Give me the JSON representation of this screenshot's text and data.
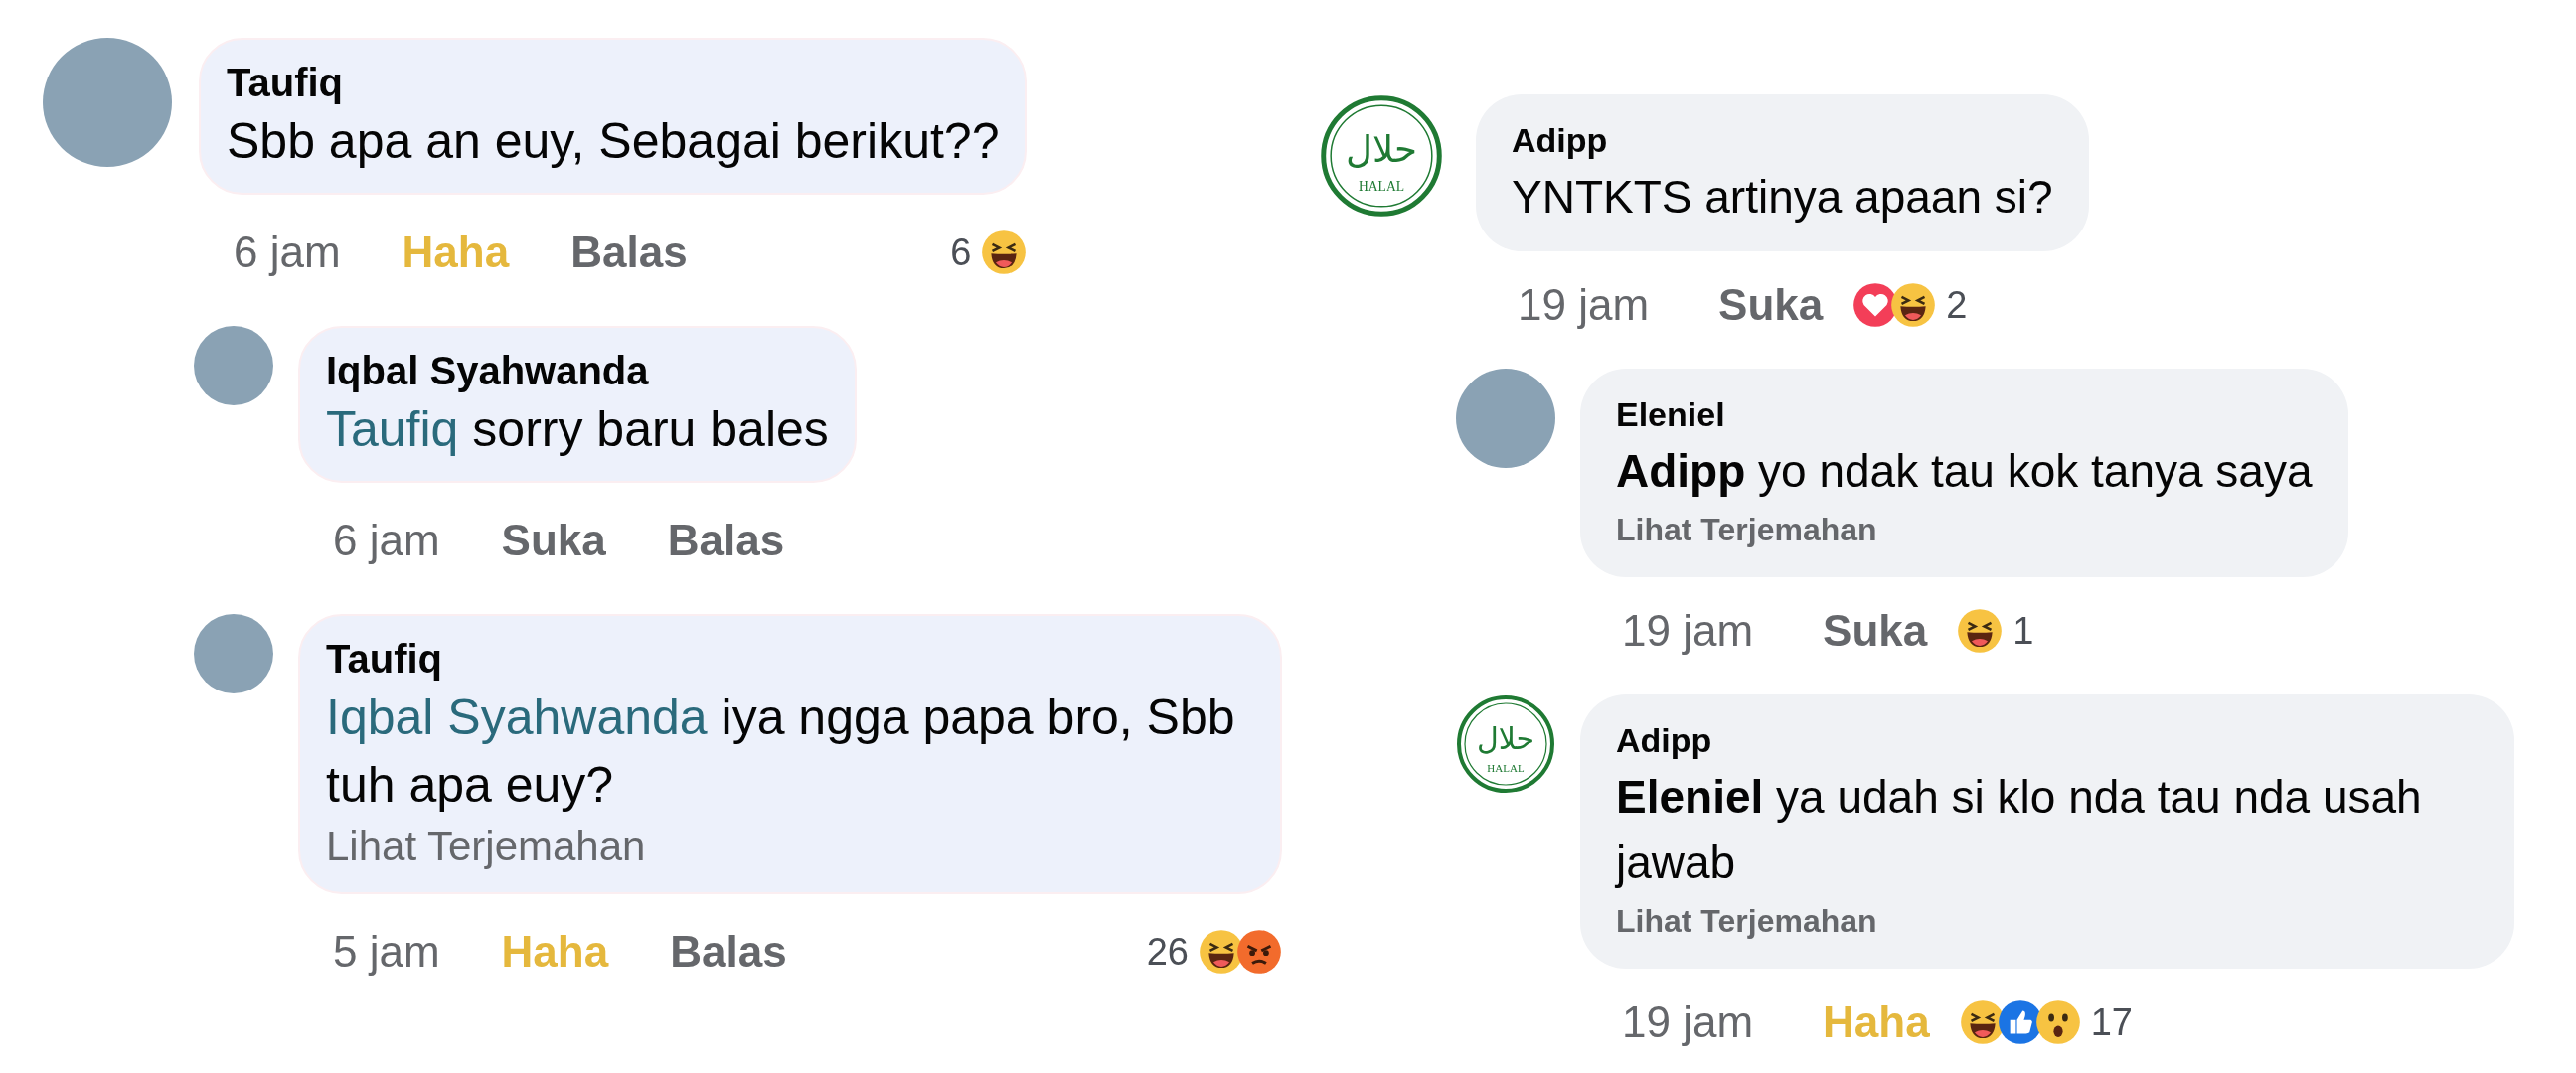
{
  "panels": [
    {
      "kind": "blue",
      "comments": [
        {
          "avatar": {
            "kind": "photo"
          },
          "name": "Taufiq",
          "text": "Sbb apa an euy, Sebagai berikut??",
          "time": "6 jam",
          "actions": [
            {
              "kind": "react",
              "label": "Haha",
              "reacted": true
            },
            {
              "kind": "reply",
              "label": "Balas"
            }
          ],
          "reactions": {
            "icons": [
              {
                "kind": "haha"
              }
            ],
            "count": "6"
          },
          "children": [
            {
              "avatar": {
                "kind": "photo"
              },
              "name": "Iqbal Syahwanda",
              "mention": "Taufiq",
              "text": " sorry baru bales",
              "time": "6 jam",
              "actions": [
                {
                  "kind": "react",
                  "label": "Suka",
                  "reacted": false
                },
                {
                  "kind": "reply",
                  "label": "Balas"
                }
              ]
            },
            {
              "avatar": {
                "kind": "photo"
              },
              "name": "Taufiq",
              "mention": "Iqbal Syahwanda",
              "text": " iya ngga papa bro, Sbb tuh apa euy?",
              "translate": "Lihat Terjemahan",
              "time": "5 jam",
              "actions": [
                {
                  "kind": "react",
                  "label": "Haha",
                  "reacted": true
                },
                {
                  "kind": "reply",
                  "label": "Balas"
                }
              ],
              "reactions": {
                "icons": [
                  {
                    "kind": "haha"
                  },
                  {
                    "kind": "angry"
                  }
                ],
                "count": "26"
              }
            }
          ]
        }
      ]
    },
    {
      "kind": "grey",
      "comments": [
        {
          "avatar": {
            "kind": "logo",
            "script": "حلال",
            "caption": "HALAL"
          },
          "name": "Adipp",
          "text": "YNTKTS artinya apaan si?",
          "time": "19 jam",
          "actions": [
            {
              "kind": "react",
              "label": "Suka",
              "reacted": false
            }
          ],
          "reactions": {
            "icons": [
              {
                "kind": "love"
              },
              {
                "kind": "haha"
              }
            ],
            "count": "2"
          },
          "children": [
            {
              "avatar": {
                "kind": "photo"
              },
              "name": "Eleniel",
              "mention": "Adipp",
              "text": " yo ndak tau kok tanya saya",
              "translate": "Lihat Terjemahan",
              "time": "19 jam",
              "actions": [
                {
                  "kind": "react",
                  "label": "Suka",
                  "reacted": false
                }
              ],
              "reactions": {
                "icons": [
                  {
                    "kind": "haha"
                  }
                ],
                "count": "1"
              }
            },
            {
              "avatar": {
                "kind": "logo",
                "script": "حلال",
                "caption": "HALAL"
              },
              "name": "Adipp",
              "mention": "Eleniel",
              "text": " ya udah si klo nda tau nda usah jawab",
              "translate": "Lihat Terjemahan",
              "time": "19 jam",
              "actions": [
                {
                  "kind": "react",
                  "label": "Haha",
                  "reacted": true
                }
              ],
              "reactions": {
                "icons": [
                  {
                    "kind": "haha"
                  },
                  {
                    "kind": "like"
                  },
                  {
                    "kind": "wow"
                  }
                ],
                "count": "17"
              }
            }
          ]
        }
      ]
    }
  ]
}
